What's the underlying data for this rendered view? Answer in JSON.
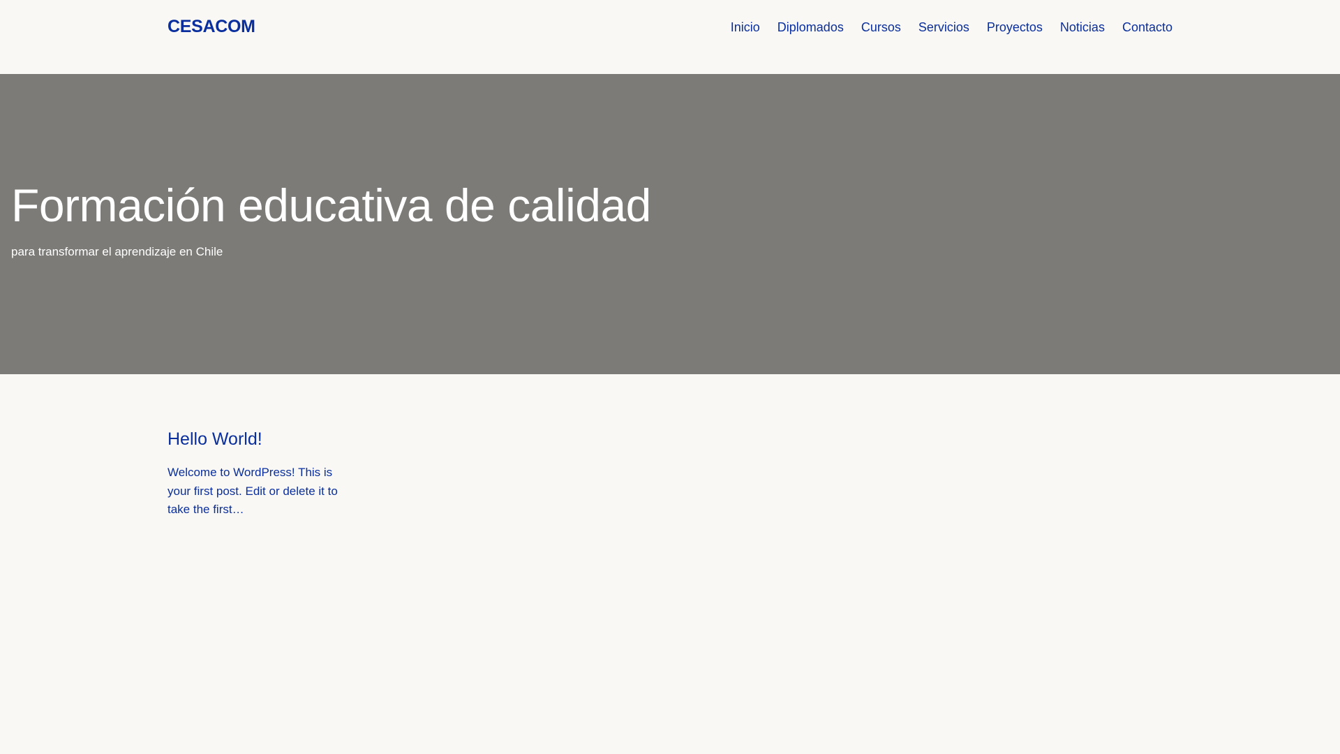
{
  "header": {
    "logo": "CESACOM",
    "nav": [
      "Inicio",
      "Diplomados",
      "Cursos",
      "Servicios",
      "Proyectos",
      "Noticias",
      "Contacto"
    ]
  },
  "hero": {
    "title": "Formación educativa de calidad",
    "subtitle": "para transformar el aprendizaje en Chile"
  },
  "post": {
    "title": "Hello World!",
    "excerpt": "Welcome to WordPress! This is your first post. Edit or delete it to take the first…"
  },
  "colors": {
    "background": "#f9f8f5",
    "hero": "#7c7b78",
    "accent": "#0a2f9c"
  }
}
